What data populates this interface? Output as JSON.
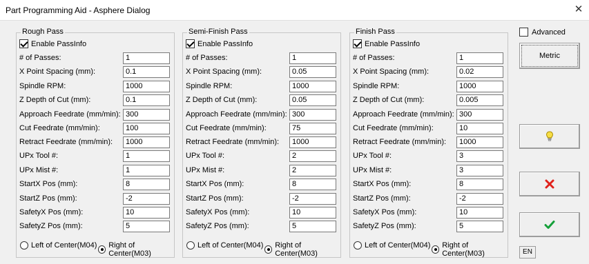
{
  "window": {
    "title": "Part Programming Aid - Asphere Dialog",
    "close_glyph": "✕"
  },
  "groups": [
    {
      "title": "Rough Pass",
      "enable_label": "Enable PassInfo",
      "enabled": true,
      "fields": [
        {
          "label": "# of Passes:",
          "value": "1"
        },
        {
          "label": "X Point Spacing (mm):",
          "value": "0.1"
        },
        {
          "label": "Spindle RPM:",
          "value": "1000"
        },
        {
          "label": "Z Depth of Cut (mm):",
          "value": "0.1"
        },
        {
          "label": "Approach Feedrate (mm/min):",
          "value": "300"
        },
        {
          "label": "Cut Feedrate (mm/min):",
          "value": "100"
        },
        {
          "label": "Retract Feedrate (mm/min):",
          "value": "1000"
        },
        {
          "label": "UPx Tool #:",
          "value": "1"
        },
        {
          "label": "UPx Mist #:",
          "value": "1"
        },
        {
          "label": "StartX Pos (mm):",
          "value": "8"
        },
        {
          "label": "StartZ Pos (mm):",
          "value": "-2"
        },
        {
          "label": "SafetyX Pos (mm):",
          "value": "10"
        },
        {
          "label": "SafetyZ Pos (mm):",
          "value": "5"
        }
      ],
      "radio_left": "Left of Center(M04)",
      "radio_right": "Right of Center(M03)",
      "selected": "right"
    },
    {
      "title": "Semi-Finish Pass",
      "enable_label": "Enable PassInfo",
      "enabled": true,
      "fields": [
        {
          "label": "# of Passes:",
          "value": "1"
        },
        {
          "label": "X Point Spacing (mm):",
          "value": "0.05"
        },
        {
          "label": "Spindle RPM:",
          "value": "1000"
        },
        {
          "label": "Z Depth of Cut (mm):",
          "value": "0.05"
        },
        {
          "label": "Approach Feedrate (mm/min):",
          "value": "300"
        },
        {
          "label": "Cut Feedrate (mm/min):",
          "value": "75"
        },
        {
          "label": "Retract Feedrate (mm/min):",
          "value": "1000"
        },
        {
          "label": "UPx Tool #:",
          "value": "2"
        },
        {
          "label": "UPx Mist #:",
          "value": "2"
        },
        {
          "label": "StartX Pos (mm):",
          "value": "8"
        },
        {
          "label": "StartZ Pos (mm):",
          "value": "-2"
        },
        {
          "label": "SafetyX Pos (mm):",
          "value": "10"
        },
        {
          "label": "SafetyZ Pos (mm):",
          "value": "5"
        }
      ],
      "radio_left": "Left of Center(M04)",
      "radio_right": "Right of Center(M03)",
      "selected": "right"
    },
    {
      "title": "Finish Pass",
      "enable_label": "Enable PassInfo",
      "enabled": true,
      "fields": [
        {
          "label": "# of Passes:",
          "value": "1"
        },
        {
          "label": "X Point Spacing (mm):",
          "value": "0.02"
        },
        {
          "label": "Spindle RPM:",
          "value": "1000"
        },
        {
          "label": "Z Depth of Cut (mm):",
          "value": "0.005"
        },
        {
          "label": "Approach Feedrate (mm/min):",
          "value": "300"
        },
        {
          "label": "Cut Feedrate (mm/min):",
          "value": "10"
        },
        {
          "label": "Retract Feedrate (mm/min):",
          "value": "1000"
        },
        {
          "label": "UPx Tool #:",
          "value": "3"
        },
        {
          "label": "UPx Mist #:",
          "value": "3"
        },
        {
          "label": "StartX Pos (mm):",
          "value": "8"
        },
        {
          "label": "StartZ Pos (mm):",
          "value": "-2"
        },
        {
          "label": "SafetyX Pos (mm):",
          "value": "10"
        },
        {
          "label": "SafetyZ Pos (mm):",
          "value": "5"
        }
      ],
      "radio_left": "Left of Center(M04)",
      "radio_right": "Right of Center(M03)",
      "selected": "right"
    }
  ],
  "side": {
    "advanced_label": "Advanced",
    "advanced_checked": false,
    "metric_label": "Metric",
    "help_icon": "lightbulb-icon",
    "cancel_icon": "red-x-icon",
    "ok_icon": "green-check-icon",
    "lang_label": "EN"
  },
  "colors": {
    "cancel": "#e0211b",
    "ok": "#15a03a",
    "help": "#d9b800"
  }
}
